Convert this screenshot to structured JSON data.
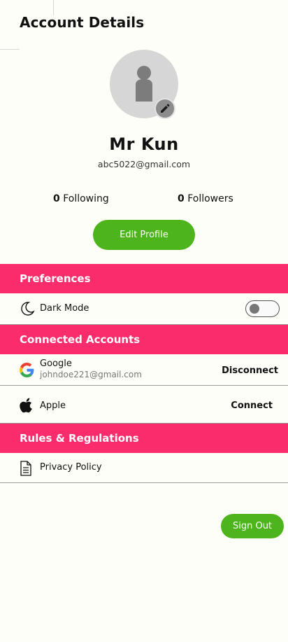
{
  "header": {
    "title": "Account Details"
  },
  "profile": {
    "name": "Mr Kun",
    "email": "abc5022@gmail.com",
    "following_count": "0",
    "following_label": "Following",
    "followers_count": "0",
    "followers_label": "Followers",
    "edit_button": "Edit Profile"
  },
  "preferences": {
    "title": "Preferences",
    "dark_mode": {
      "label": "Dark Mode",
      "enabled": false
    }
  },
  "connected_accounts": {
    "title": "Connected Accounts",
    "items": [
      {
        "name": "Google",
        "email": "johndoe221@gmail.com",
        "action": "Disconnect",
        "icon": "google-icon"
      },
      {
        "name": "Apple",
        "email": "",
        "action": "Connect",
        "icon": "apple-icon"
      }
    ]
  },
  "rules": {
    "title": "Rules & Regulations",
    "items": [
      {
        "label": "Privacy Policy",
        "icon": "document-icon"
      }
    ]
  },
  "footer": {
    "sign_out": "Sign Out"
  },
  "colors": {
    "accent_pink": "#fb2c6b",
    "button_green": "#4db51b",
    "background": "#fdfef7"
  }
}
